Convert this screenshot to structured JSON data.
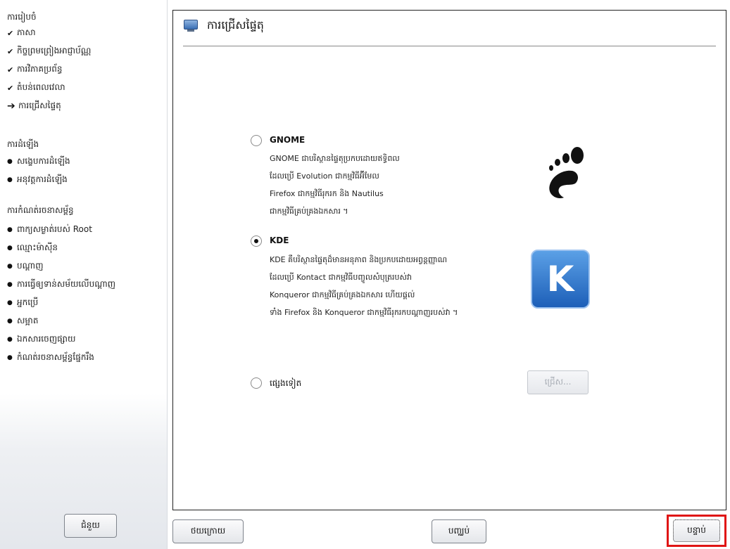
{
  "sidebar": {
    "section1": "ការរៀបចំ",
    "items1": [
      {
        "mark": "✔",
        "label": "ភាសា"
      },
      {
        "mark": "✔",
        "label": "កិច្ចព្រមព្រៀងអាជ្ញាប័ណ្ណ"
      },
      {
        "mark": "✔",
        "label": "ការវិភាគប្រព័ន្ធ"
      },
      {
        "mark": "✔",
        "label": "តំបន់ពេលវេលា"
      },
      {
        "mark": "➔",
        "label": "ការជ្រើសផ្ទៃតុ"
      }
    ],
    "section2": "ការដំឡើង",
    "items2": [
      {
        "mark": "●",
        "label": "សង្ខេបការដំឡើង"
      },
      {
        "mark": "●",
        "label": "អនុវត្តការដំឡើង"
      }
    ],
    "section3": "ការកំណត់រចនាសម្ព័ន្ធ",
    "items3": [
      {
        "mark": "●",
        "label": "ពាក្យសម្ងាត់របស់ Root"
      },
      {
        "mark": "●",
        "label": "ឈ្មោះម៉ាស៊ីន"
      },
      {
        "mark": "●",
        "label": "បណ្ដាញ"
      },
      {
        "mark": "●",
        "label": "ការធ្វើឲ្យទាន់សម័យលើបណ្ដាញ"
      },
      {
        "mark": "●",
        "label": "អ្នកប្រើ"
      },
      {
        "mark": "●",
        "label": "សម្អាត"
      },
      {
        "mark": "●",
        "label": "ឯកសារចេញផ្សាយ"
      },
      {
        "mark": "●",
        "label": "កំណត់រចនាសម្ព័ន្ធផ្នែករឹង"
      }
    ]
  },
  "main": {
    "title": "ការជ្រើសផ្ទៃតុ",
    "gnome": {
      "label": "GNOME",
      "checked": false,
      "desc": [
        "GNOME ជាបរិស្ថានផ្ទៃតុប្រកបដោយឥទ្ធិពល",
        "ដែលប្រើ Evolution ជាកម្មវិធីអ៊ីមែល",
        "Firefox ជាកម្មវិធីរុករក និង Nautilus",
        "ជាកម្មវិធីគ្រប់គ្រងឯកសារ ។"
      ],
      "logo_icon": "gnome-foot-icon"
    },
    "kde": {
      "label": "KDE",
      "checked": true,
      "desc": [
        "KDE គឺបរិស្ថានផ្ទៃតុដ៏មានអនុភាព និងប្រកបដោយអព្វន្តញ្ញាណ",
        "ដែលប្រើ Kontact ជាកម្មវិធីបញ្ចូលសំបុត្ររបស់វា",
        "Konqueror ជាកម្មវិធីគ្រប់គ្រងឯកសារ ហើយផ្ដល់",
        "ទាំង Firefox និង Konqueror ជាកម្មវិធីរុករកបណ្ដាញរបស់វា ។"
      ],
      "logo_text": "K",
      "logo_icon": "kde-logo-icon"
    },
    "other": {
      "label": "ផ្សេងទៀត",
      "checked": false,
      "choose_label": "ជ្រើស..."
    }
  },
  "buttons": {
    "help": "ជំនួយ",
    "back": "ថយក្រោយ",
    "cancel": "បញ្ឈប់",
    "next": "បន្ទាប់"
  }
}
